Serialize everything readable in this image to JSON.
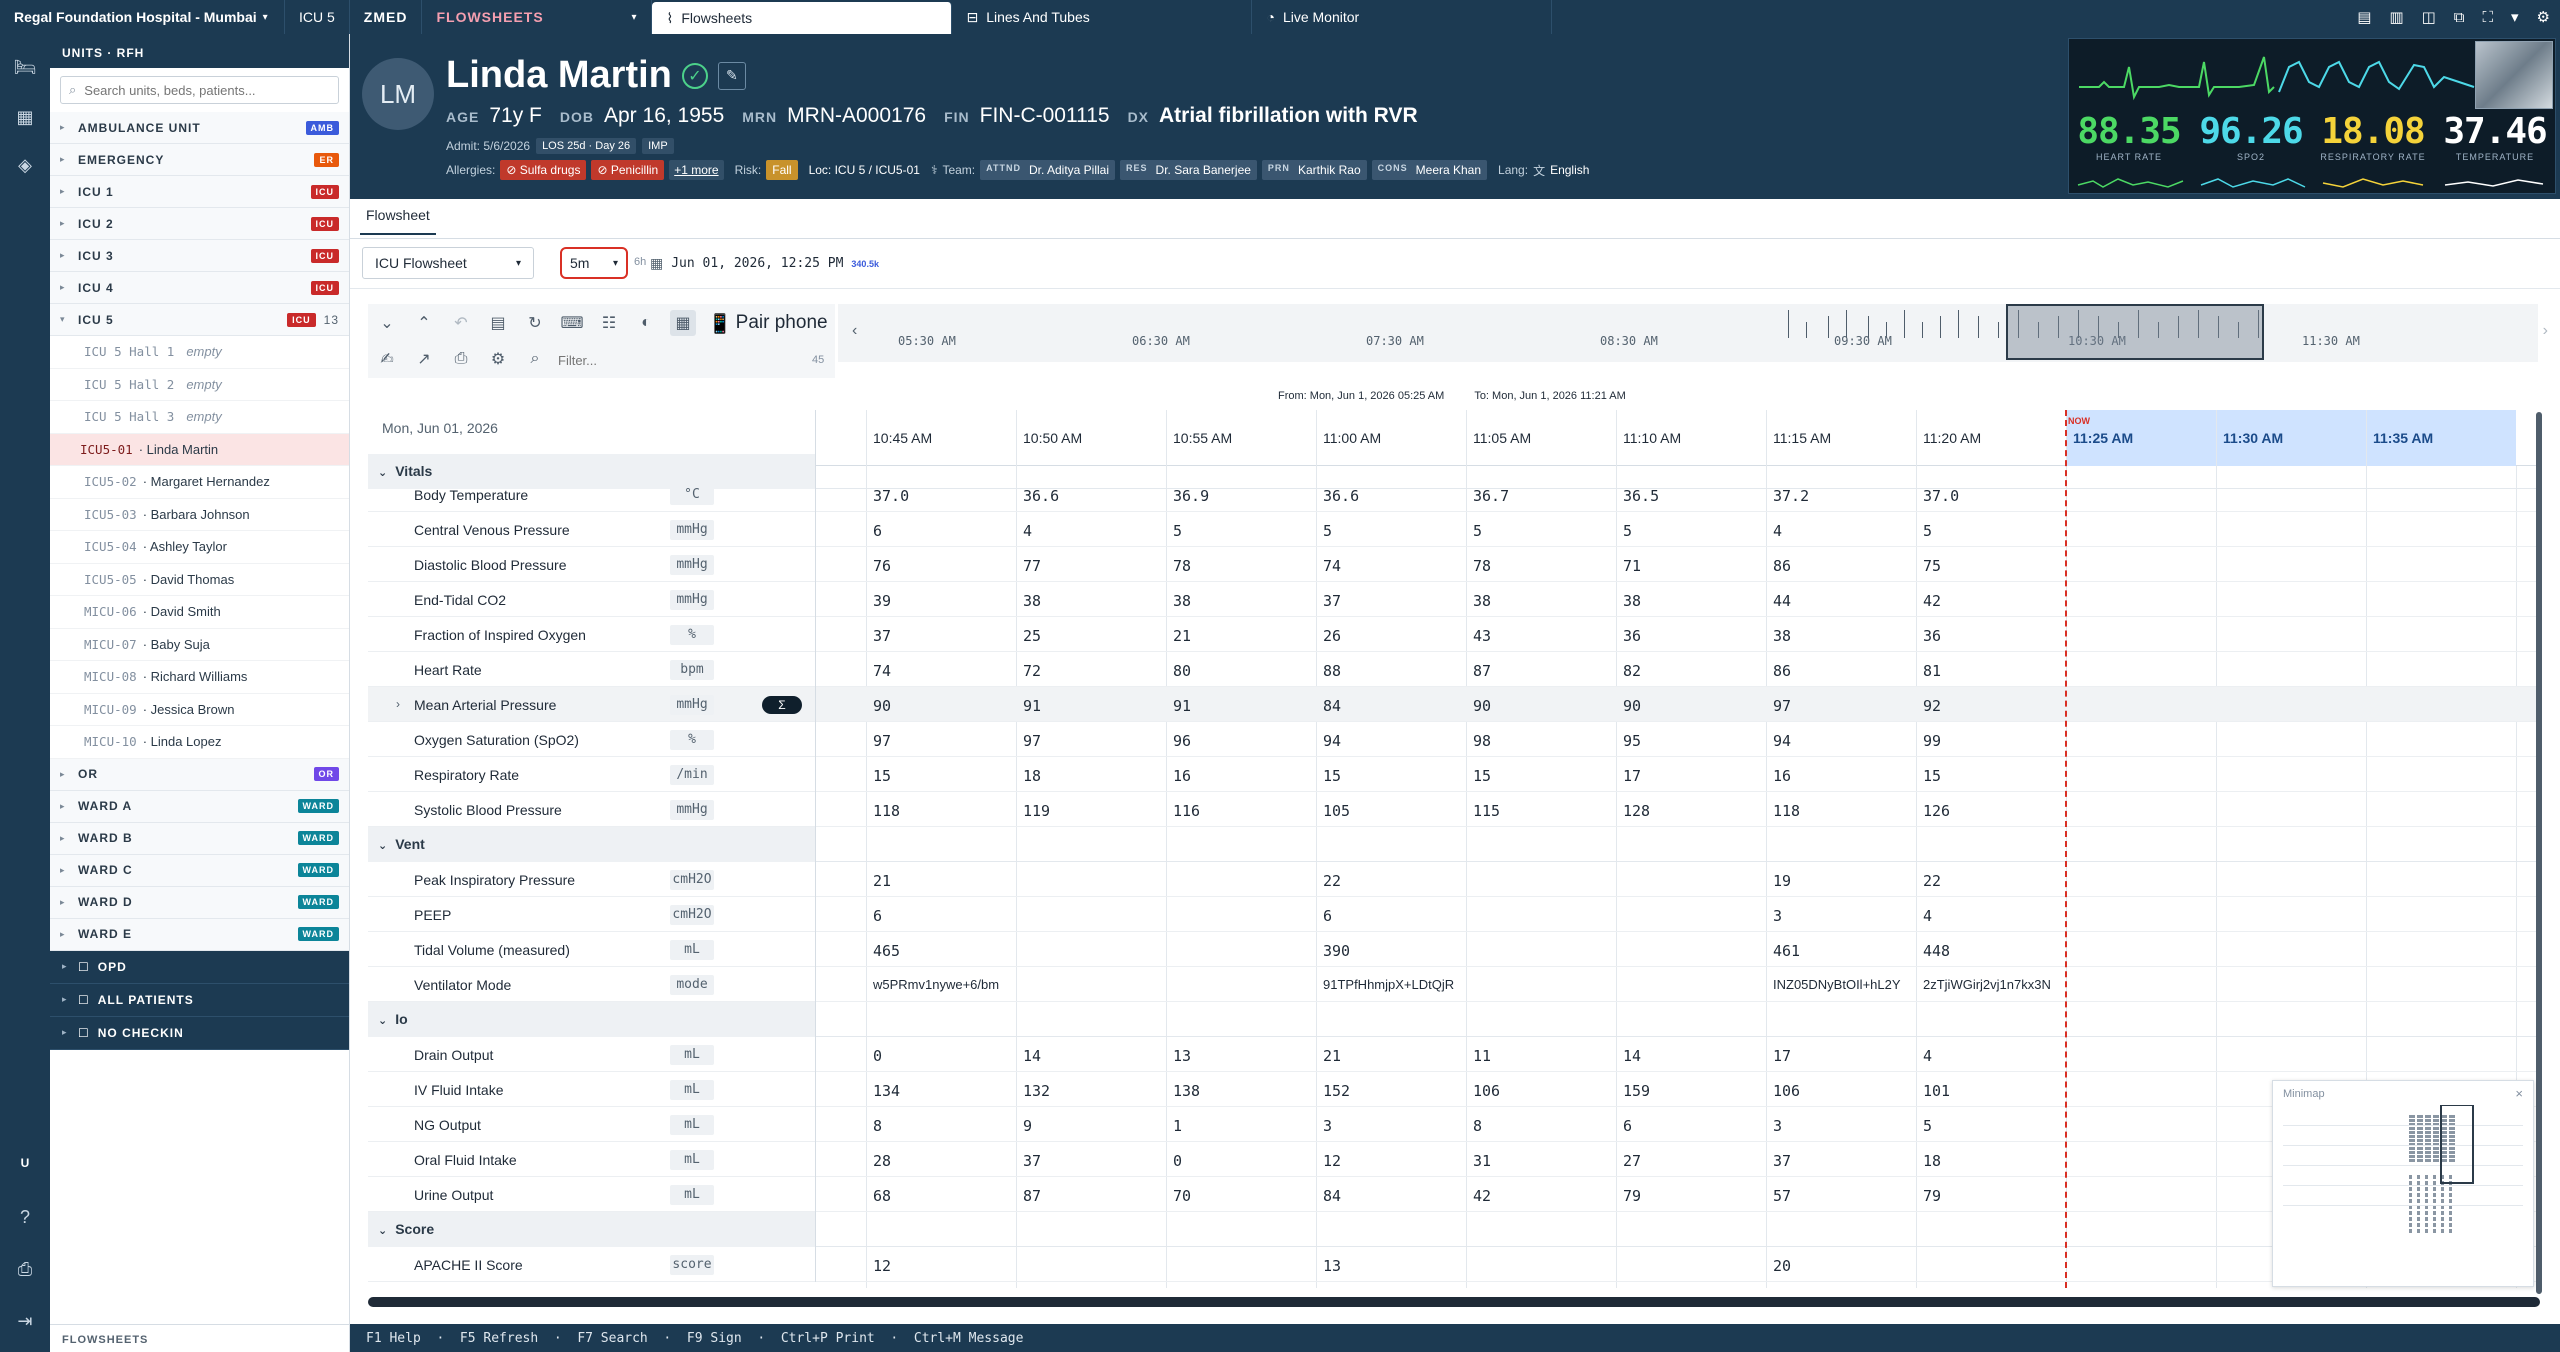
{
  "topbar": {
    "hospital": "Regal Foundation Hospital - Mumbai",
    "unit": "ICU 5",
    "app": "ZMED",
    "module": "FLOWSHEETS",
    "tabs": [
      {
        "label": "Flowsheets",
        "icon": "chart-icon",
        "active": true
      },
      {
        "label": "Lines And Tubes",
        "icon": "tube-icon",
        "active": false
      },
      {
        "label": "Live Monitor",
        "icon": "monitor-icon",
        "active": false
      }
    ]
  },
  "sidebar": {
    "title": "UNITS · RFH",
    "search_placeholder": "Search units, beds, patients...",
    "units": [
      {
        "label": "AMBULANCE UNIT",
        "badge": "AMB",
        "color": "#3b5bdb"
      },
      {
        "label": "EMERGENCY",
        "badge": "ER",
        "color": "#e8590c"
      },
      {
        "label": "ICU 1",
        "badge": "ICU",
        "color": "#c92a2a"
      },
      {
        "label": "ICU 2",
        "badge": "ICU",
        "color": "#c92a2a"
      },
      {
        "label": "ICU 3",
        "badge": "ICU",
        "color": "#c92a2a"
      },
      {
        "label": "ICU 4",
        "badge": "ICU",
        "color": "#c92a2a"
      }
    ],
    "open_unit": {
      "label": "ICU 5",
      "badge": "ICU",
      "count": "13"
    },
    "beds": [
      {
        "code": "ICU 5 Hall 1",
        "name": "",
        "status": "empty"
      },
      {
        "code": "ICU 5 Hall 2",
        "name": "",
        "status": "empty"
      },
      {
        "code": "ICU 5 Hall 3",
        "name": "",
        "status": "empty"
      },
      {
        "code": "ICU5-01",
        "name": "· Linda Martin",
        "status": "",
        "active": true
      },
      {
        "code": "ICU5-02",
        "name": "· Margaret Hernandez",
        "status": ""
      },
      {
        "code": "ICU5-03",
        "name": "· Barbara Johnson",
        "status": ""
      },
      {
        "code": "ICU5-04",
        "name": "· Ashley Taylor",
        "status": ""
      },
      {
        "code": "ICU5-05",
        "name": "· David Thomas",
        "status": ""
      },
      {
        "code": "MICU-06",
        "name": "· David Smith",
        "status": ""
      },
      {
        "code": "MICU-07",
        "name": "· Baby Suja",
        "status": ""
      },
      {
        "code": "MICU-08",
        "name": "· Richard Williams",
        "status": ""
      },
      {
        "code": "MICU-09",
        "name": "· Jessica Brown",
        "status": ""
      },
      {
        "code": "MICU-10",
        "name": "· Linda Lopez",
        "status": ""
      }
    ],
    "units_after": [
      {
        "label": "OR",
        "badge": "OR",
        "color": "#7048e8"
      },
      {
        "label": "WARD A",
        "badge": "WARD",
        "color": "#0c8599"
      },
      {
        "label": "WARD B",
        "badge": "WARD",
        "color": "#0c8599"
      },
      {
        "label": "WARD C",
        "badge": "WARD",
        "color": "#0c8599"
      },
      {
        "label": "WARD D",
        "badge": "WARD",
        "color": "#0c8599"
      },
      {
        "label": "WARD E",
        "badge": "WARD",
        "color": "#0c8599"
      }
    ],
    "nav": [
      {
        "label": "OPD",
        "icon": "clipboard-icon"
      },
      {
        "label": "ALL PATIENTS",
        "icon": "users-icon"
      },
      {
        "label": "NO CHECKIN",
        "icon": "user-x-icon"
      }
    ],
    "footer": "FLOWSHEETS"
  },
  "rail": {
    "user_initial": "U"
  },
  "patient": {
    "initials": "LM",
    "name": "Linda Martin",
    "age_label": "AGE",
    "age": "71y F",
    "dob_label": "DOB",
    "dob": "Apr 16, 1955",
    "mrn_label": "MRN",
    "mrn": "MRN-A000176",
    "fin_label": "FIN",
    "fin": "FIN-C-001115",
    "dx_label": "DX",
    "dx": "Atrial fibrillation with RVR",
    "admit": "Admit: 5/6/2026",
    "los": "LOS 25d · Day 26",
    "type": "IMP",
    "allergies_label": "Allergies:",
    "allergies": [
      "Sulfa drugs",
      "Penicillin"
    ],
    "allergies_more": "+1 more",
    "risk_label": "Risk:",
    "risk": "Fall",
    "loc": "Loc: ICU 5 / ICU5-01",
    "team_label": "Team:",
    "team": [
      {
        "role": "ATTND",
        "name": "Dr. Aditya Pillai"
      },
      {
        "role": "RES",
        "name": "Dr. Sara Banerjee"
      },
      {
        "role": "PRN",
        "name": "Karthik Rao"
      },
      {
        "role": "CONS",
        "name": "Meera Khan"
      }
    ],
    "lang_label": "Lang:",
    "lang": "English"
  },
  "monitor": {
    "vitals": [
      {
        "value": "88.35",
        "label": "HEART RATE",
        "color": "#4cd964"
      },
      {
        "value": "96.26",
        "label": "SPO2",
        "color": "#4dd9e8"
      },
      {
        "value": "18.08",
        "label": "RESPIRATORY RATE",
        "color": "#f5d33a"
      },
      {
        "value": "37.46",
        "label": "TEMPERATURE",
        "color": "#ffffff"
      }
    ]
  },
  "flowsheet_tab": "Flowsheet",
  "controls": {
    "sheet": "ICU Flowsheet",
    "interval": "5m",
    "interval_alt": "6h",
    "datetime": "Jun 01, 2026, 12:25 PM",
    "count_badge": "340.5k"
  },
  "toolbar": {
    "pair_phone": "Pair phone",
    "filter_placeholder": "Filter...",
    "filter_count": "45"
  },
  "timeline": {
    "labels": [
      "05:30 AM",
      "06:30 AM",
      "07:30 AM",
      "08:30 AM",
      "09:30 AM",
      "10:30 AM",
      "11:30 AM"
    ]
  },
  "range": {
    "from": "From: Mon, Jun 1, 2026 05:25 AM",
    "to": "To: Mon, Jun 1, 2026 11:21 AM"
  },
  "grid": {
    "date": "Mon, Jun 01, 2026",
    "times": [
      "10:45 AM",
      "10:50 AM",
      "10:55 AM",
      "11:00 AM",
      "11:05 AM",
      "11:10 AM",
      "11:15 AM",
      "11:20 AM",
      "11:25 AM",
      "11:30 AM",
      "11:35 AM"
    ],
    "now_label": "NOW",
    "groups": [
      {
        "name": "Vitals",
        "rows": [
          {
            "label": "Body Temperature",
            "unit": "°C",
            "values": [
              "37.0",
              "36.6",
              "36.9",
              "36.6",
              "36.7",
              "36.5",
              "37.2",
              "37.0"
            ]
          },
          {
            "label": "Central Venous Pressure",
            "unit": "mmHg",
            "values": [
              "6",
              "4",
              "5",
              "5",
              "5",
              "5",
              "4",
              "5"
            ]
          },
          {
            "label": "Diastolic Blood Pressure",
            "unit": "mmHg",
            "values": [
              "76",
              "77",
              "78",
              "74",
              "78",
              "71",
              "86",
              "75"
            ]
          },
          {
            "label": "End-Tidal CO2",
            "unit": "mmHg",
            "values": [
              "39",
              "38",
              "38",
              "37",
              "38",
              "38",
              "44",
              "42"
            ]
          },
          {
            "label": "Fraction of Inspired Oxygen",
            "unit": "%",
            "values": [
              "37",
              "25",
              "21",
              "26",
              "43",
              "36",
              "38",
              "36"
            ]
          },
          {
            "label": "Heart Rate",
            "unit": "bpm",
            "values": [
              "74",
              "72",
              "80",
              "88",
              "87",
              "82",
              "86",
              "81"
            ]
          },
          {
            "label": "Mean Arterial Pressure",
            "unit": "mmHg",
            "values": [
              "90",
              "91",
              "91",
              "84",
              "90",
              "90",
              "97",
              "92"
            ],
            "expandable": true,
            "sigma": "Σ"
          },
          {
            "label": "Oxygen Saturation (SpO2)",
            "unit": "%",
            "values": [
              "97",
              "97",
              "96",
              "94",
              "98",
              "95",
              "94",
              "99"
            ]
          },
          {
            "label": "Respiratory Rate",
            "unit": "/min",
            "values": [
              "15",
              "18",
              "16",
              "15",
              "15",
              "17",
              "16",
              "15"
            ]
          },
          {
            "label": "Systolic Blood Pressure",
            "unit": "mmHg",
            "values": [
              "118",
              "119",
              "116",
              "105",
              "115",
              "128",
              "118",
              "126"
            ]
          }
        ]
      },
      {
        "name": "Vent",
        "rows": [
          {
            "label": "Peak Inspiratory Pressure",
            "unit": "cmH2O",
            "values": [
              "21",
              "",
              "",
              "22",
              "",
              "",
              "19",
              "22"
            ]
          },
          {
            "label": "PEEP",
            "unit": "cmH2O",
            "values": [
              "6",
              "",
              "",
              "6",
              "",
              "",
              "3",
              "4"
            ]
          },
          {
            "label": "Tidal Volume (measured)",
            "unit": "mL",
            "values": [
              "465",
              "",
              "",
              "390",
              "",
              "",
              "461",
              "448"
            ]
          },
          {
            "label": "Ventilator Mode",
            "unit": "mode",
            "values": [
              "w5PRmv1nywe+6/bm",
              "",
              "",
              "91TPfHhmjpX+LDtQjR",
              "",
              "",
              "INZ05DNyBtOIl+hL2Y",
              "2zTjiWGirj2vj1n7kx3N"
            ],
            "text": true
          }
        ]
      },
      {
        "name": "Io",
        "rows": [
          {
            "label": "Drain Output",
            "unit": "mL",
            "values": [
              "0",
              "14",
              "13",
              "21",
              "11",
              "14",
              "17",
              "4"
            ]
          },
          {
            "label": "IV Fluid Intake",
            "unit": "mL",
            "values": [
              "134",
              "132",
              "138",
              "152",
              "106",
              "159",
              "106",
              "101"
            ]
          },
          {
            "label": "NG Output",
            "unit": "mL",
            "values": [
              "8",
              "9",
              "1",
              "3",
              "8",
              "6",
              "3",
              "5"
            ]
          },
          {
            "label": "Oral Fluid Intake",
            "unit": "mL",
            "values": [
              "28",
              "37",
              "0",
              "12",
              "31",
              "27",
              "37",
              "18"
            ]
          },
          {
            "label": "Urine Output",
            "unit": "mL",
            "values": [
              "68",
              "87",
              "70",
              "84",
              "42",
              "79",
              "57",
              "79"
            ]
          }
        ]
      },
      {
        "name": "Score",
        "rows": [
          {
            "label": "APACHE II Score",
            "unit": "score",
            "values": [
              "12",
              "",
              "",
              "13",
              "",
              "",
              "20",
              ""
            ]
          }
        ]
      }
    ]
  },
  "minimap": {
    "title": "Minimap"
  },
  "statusbar": "F1 Help  ·  F5 Refresh  ·  F7 Search  ·  F9 Sign  ·  Ctrl+P Print  ·  Ctrl+M Message"
}
